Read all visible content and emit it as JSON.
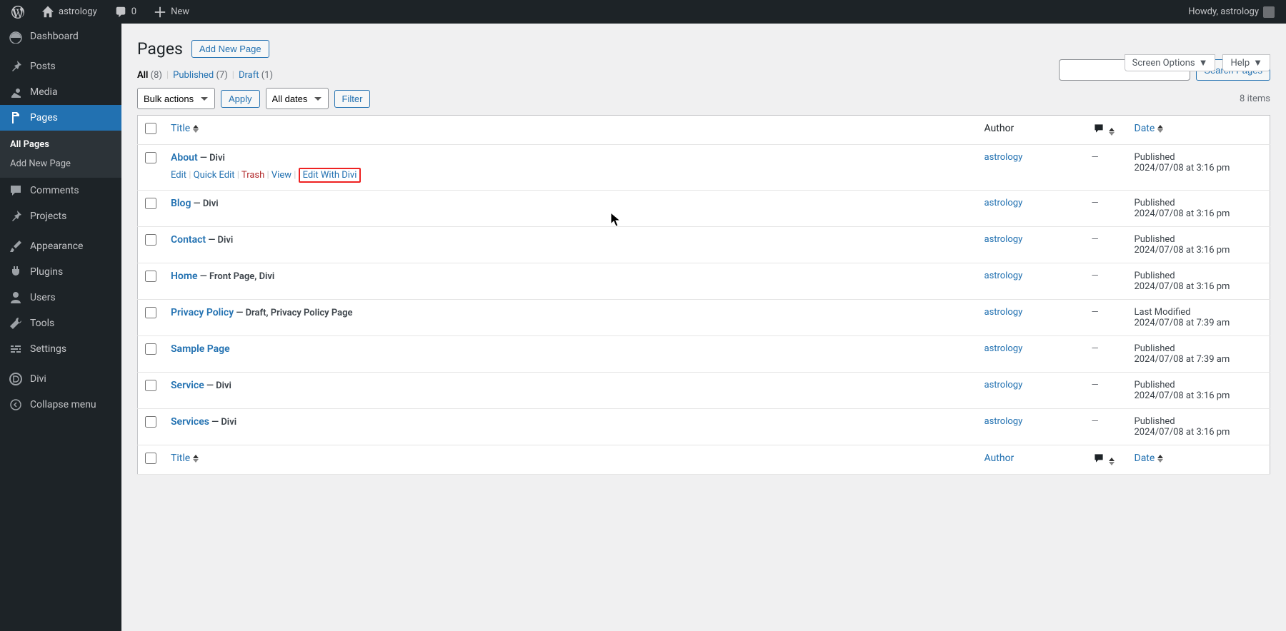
{
  "adminbar": {
    "site_name": "astrology",
    "comments_count": "0",
    "new_label": "New",
    "howdy": "Howdy, astrology"
  },
  "sidebar": {
    "dashboard": "Dashboard",
    "posts": "Posts",
    "media": "Media",
    "pages": "Pages",
    "all_pages": "All Pages",
    "add_new": "Add New Page",
    "comments": "Comments",
    "projects": "Projects",
    "appearance": "Appearance",
    "plugins": "Plugins",
    "users": "Users",
    "tools": "Tools",
    "settings": "Settings",
    "divi": "Divi",
    "collapse": "Collapse menu"
  },
  "header": {
    "title": "Pages",
    "add_new": "Add New Page",
    "screen_options": "Screen Options",
    "help": "Help",
    "search_button": "Search Pages"
  },
  "filters": {
    "all_label": "All",
    "all_count": "(8)",
    "published_label": "Published",
    "published_count": "(7)",
    "draft_label": "Draft",
    "draft_count": "(1)",
    "bulk_actions": "Bulk actions",
    "apply": "Apply",
    "all_dates": "All dates",
    "filter": "Filter",
    "items_count": "8 items"
  },
  "columns": {
    "title": "Title",
    "author": "Author",
    "date": "Date"
  },
  "row_actions": {
    "edit": "Edit",
    "quick_edit": "Quick Edit",
    "trash": "Trash",
    "view": "View",
    "edit_divi": "Edit With Divi"
  },
  "rows": [
    {
      "title": "About",
      "suffix": " — Divi",
      "author": "astrology",
      "comments": "—",
      "status": "Published",
      "date": "2024/07/08 at 3:16 pm",
      "show_actions": true
    },
    {
      "title": "Blog",
      "suffix": " — Divi",
      "author": "astrology",
      "comments": "—",
      "status": "Published",
      "date": "2024/07/08 at 3:16 pm"
    },
    {
      "title": "Contact",
      "suffix": " — Divi",
      "author": "astrology",
      "comments": "—",
      "status": "Published",
      "date": "2024/07/08 at 3:16 pm"
    },
    {
      "title": "Home",
      "suffix": " — Front Page, Divi",
      "author": "astrology",
      "comments": "—",
      "status": "Published",
      "date": "2024/07/08 at 3:16 pm"
    },
    {
      "title": "Privacy Policy",
      "suffix": " — Draft, Privacy Policy Page",
      "author": "astrology",
      "comments": "—",
      "status": "Last Modified",
      "date": "2024/07/08 at 7:39 am"
    },
    {
      "title": "Sample Page",
      "suffix": "",
      "author": "astrology",
      "comments": "—",
      "status": "Published",
      "date": "2024/07/08 at 7:39 am"
    },
    {
      "title": "Service",
      "suffix": " — Divi",
      "author": "astrology",
      "comments": "—",
      "status": "Published",
      "date": "2024/07/08 at 3:16 pm"
    },
    {
      "title": "Services",
      "suffix": " — Divi",
      "author": "astrology",
      "comments": "—",
      "status": "Published",
      "date": "2024/07/08 at 3:16 pm"
    }
  ]
}
